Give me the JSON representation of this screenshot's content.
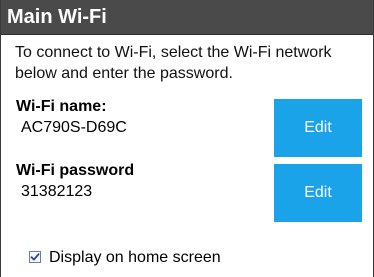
{
  "window": {
    "title": "Main Wi-Fi"
  },
  "instructions": "To connect to Wi-Fi, select the Wi-Fi network below and enter the password.",
  "wifi_name": {
    "label": "Wi-Fi name:",
    "value": "AC790S-D69C",
    "edit_label": "Edit"
  },
  "wifi_password": {
    "label": "Wi-Fi password",
    "value": "31382123",
    "edit_label": "Edit"
  },
  "home_screen_option": {
    "label": "Display on home screen",
    "checked": true
  },
  "colors": {
    "title_bar": "#4a4a4a",
    "accent_button": "#1aa3e8"
  }
}
